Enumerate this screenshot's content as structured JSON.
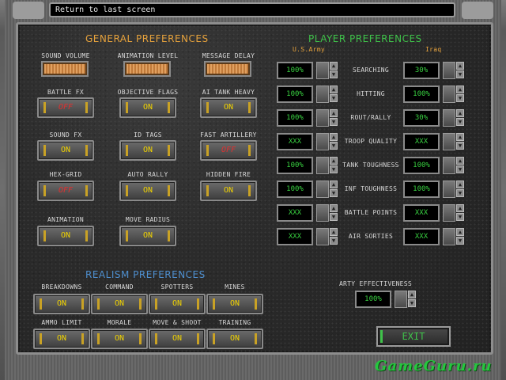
{
  "status": {
    "text": "Return to last screen"
  },
  "headers": {
    "general": "GENERAL PREFERENCES",
    "player": "PLAYER PREFERENCES",
    "realism": "REALISM PREFERENCES",
    "side_a": "U.S.Army",
    "side_b": "Iraq"
  },
  "general": {
    "sound_volume": "SOUND VOLUME",
    "animation_level": "ANIMATION LEVEL",
    "message_delay": "MESSAGE DELAY",
    "battle_fx": {
      "label": "BATTLE FX",
      "value": "OFF"
    },
    "objective_flags": {
      "label": "OBJECTIVE FLAGS",
      "value": "ON"
    },
    "ai_tank_heavy": {
      "label": "AI TANK HEAVY",
      "value": "ON"
    },
    "sound_fx": {
      "label": "SOUND FX",
      "value": "ON"
    },
    "id_tags": {
      "label": "ID TAGS",
      "value": "ON"
    },
    "fast_artillery": {
      "label": "FAST ARTILLERY",
      "value": "OFF"
    },
    "hex_grid": {
      "label": "HEX-GRID",
      "value": "OFF"
    },
    "auto_rally": {
      "label": "AUTO RALLY",
      "value": "ON"
    },
    "hidden_fire": {
      "label": "HIDDEN FIRE",
      "value": "ON"
    },
    "animation": {
      "label": "ANIMATION",
      "value": "ON"
    },
    "move_radius": {
      "label": "MOVE RADIUS",
      "value": "ON"
    }
  },
  "player": {
    "rows": [
      {
        "label": "SEARCHING",
        "us": "100%",
        "iraq": "30%"
      },
      {
        "label": "HITTING",
        "us": "100%",
        "iraq": "100%"
      },
      {
        "label": "ROUT/RALLY",
        "us": "100%",
        "iraq": "30%"
      },
      {
        "label": "TROOP QUALITY",
        "us": "XXX",
        "iraq": "XXX"
      },
      {
        "label": "TANK TOUGHNESS",
        "us": "100%",
        "iraq": "100%"
      },
      {
        "label": "INF TOUGHNESS",
        "us": "100%",
        "iraq": "100%"
      },
      {
        "label": "BATTLE POINTS",
        "us": "XXX",
        "iraq": "XXX"
      },
      {
        "label": "AIR SORTIES",
        "us": "XXX",
        "iraq": "XXX"
      }
    ],
    "arty_label": "ARTY EFFECTIVENESS",
    "arty_value": "100%"
  },
  "realism": {
    "breakdowns": {
      "label": "BREAKDOWNS",
      "value": "ON"
    },
    "command": {
      "label": "COMMAND",
      "value": "ON"
    },
    "spotters": {
      "label": "SPOTTERS",
      "value": "ON"
    },
    "mines": {
      "label": "MINES",
      "value": "ON"
    },
    "ammo_limit": {
      "label": "AMMO LIMIT",
      "value": "ON"
    },
    "morale": {
      "label": "MORALE",
      "value": "ON"
    },
    "move_shoot": {
      "label": "MOVE & SHOOT",
      "value": "ON"
    },
    "training": {
      "label": "TRAINING",
      "value": "ON"
    }
  },
  "exit_label": "EXIT",
  "watermark": "GameGuru.ru",
  "colors": {
    "on": "#f2d400",
    "off": "#e03030",
    "value": "#38d040",
    "orange_header": "#e6a23c",
    "green_header": "#3fc24a",
    "blue_header": "#4e8fcf"
  }
}
